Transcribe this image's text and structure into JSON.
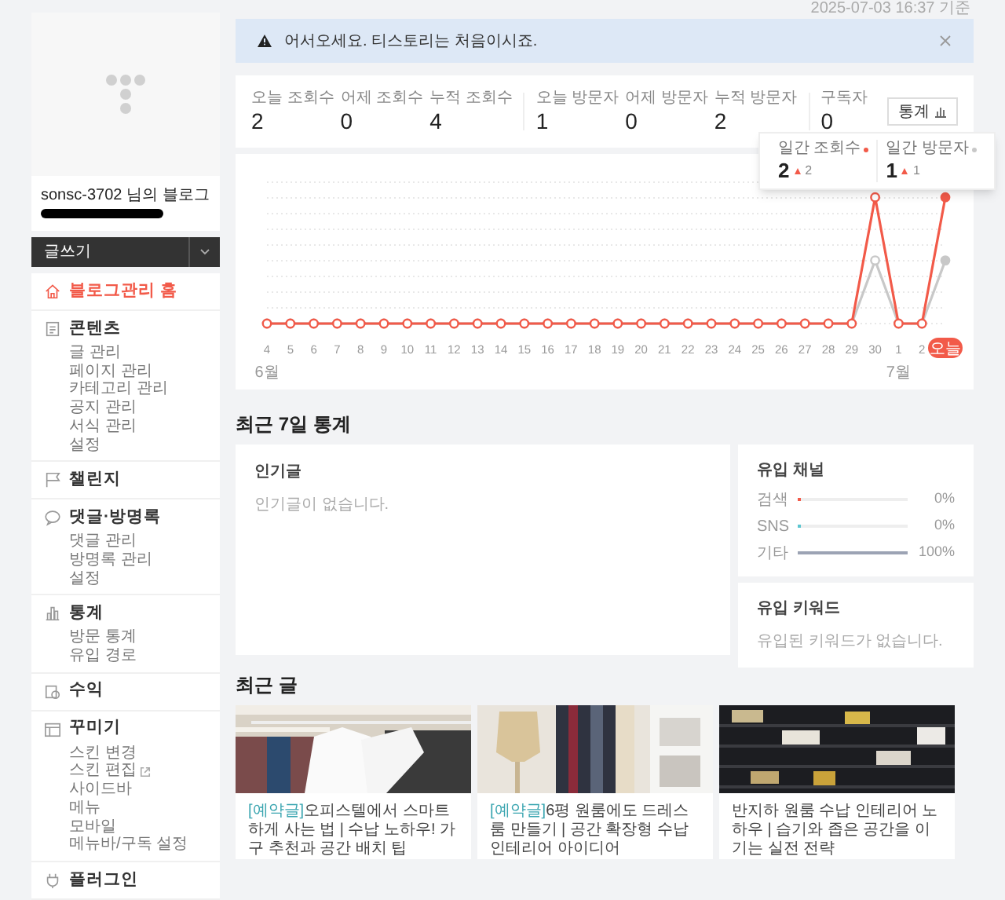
{
  "updated_at": "2025-07-03 16:37 기준",
  "sidebar": {
    "blog_name": "sonsc-3702 님의 블로그",
    "write_button": "글쓰기",
    "menu": [
      {
        "label": "블로그관리 홈",
        "selected": true
      },
      {
        "label": "콘텐츠",
        "selected": false,
        "children": [
          {
            "label": "글 관리",
            "external": false
          },
          {
            "label": "페이지 관리",
            "external": false
          },
          {
            "label": "카테고리 관리",
            "external": false
          },
          {
            "label": "공지 관리",
            "external": false
          },
          {
            "label": "서식 관리",
            "external": false
          },
          {
            "label": "설정",
            "external": false
          }
        ]
      },
      {
        "label": "챌린지",
        "selected": false
      },
      {
        "label": "댓글·방명록",
        "selected": false,
        "children": [
          {
            "label": "댓글 관리",
            "external": false
          },
          {
            "label": "방명록 관리",
            "external": false
          },
          {
            "label": "설정",
            "external": false
          }
        ]
      },
      {
        "label": "통계",
        "selected": false,
        "children": [
          {
            "label": "방문 통계",
            "external": false
          },
          {
            "label": "유입 경로",
            "external": false
          }
        ]
      },
      {
        "label": "수익",
        "selected": false
      },
      {
        "label": "꾸미기",
        "selected": false,
        "children": [
          {
            "label": "스킨 변경",
            "external": false
          },
          {
            "label": "스킨 편집",
            "external": true
          },
          {
            "label": "사이드바",
            "external": false
          },
          {
            "label": "메뉴",
            "external": false
          },
          {
            "label": "모바일",
            "external": false
          },
          {
            "label": "메뉴바/구독 설정",
            "external": false
          }
        ]
      },
      {
        "label": "플러그인",
        "selected": false
      }
    ]
  },
  "alert": {
    "text": "어서오세요. 티스토리는 처음이시죠."
  },
  "stat_groups": [
    {
      "items": [
        {
          "label": "오늘 조회수",
          "value": "2"
        },
        {
          "label": "어제 조회수",
          "value": "0"
        },
        {
          "label": "누적 조회수",
          "value": "4"
        }
      ]
    },
    {
      "items": [
        {
          "label": "오늘 방문자",
          "value": "1"
        },
        {
          "label": "어제 방문자",
          "value": "0"
        },
        {
          "label": "누적 방문자",
          "value": "2"
        }
      ]
    },
    {
      "items": [
        {
          "label": "구독자",
          "value": "0"
        }
      ]
    }
  ],
  "stats_button": "통계",
  "chart": {
    "today_highlighted": true,
    "tooltip": [
      {
        "label": "일간 조회수",
        "value": "2",
        "change": "2",
        "color": "#f25a49"
      },
      {
        "label": "일간 방문자",
        "value": "1",
        "change": "1",
        "color": "#c8c8c8"
      }
    ],
    "x_labels": [
      {
        "label": "4",
        "month": "6월"
      },
      {
        "label": "5"
      },
      {
        "label": "6"
      },
      {
        "label": "7"
      },
      {
        "label": "8"
      },
      {
        "label": "9"
      },
      {
        "label": "10"
      },
      {
        "label": "11"
      },
      {
        "label": "12"
      },
      {
        "label": "13"
      },
      {
        "label": "14"
      },
      {
        "label": "15"
      },
      {
        "label": "16"
      },
      {
        "label": "17"
      },
      {
        "label": "18"
      },
      {
        "label": "19"
      },
      {
        "label": "20"
      },
      {
        "label": "21"
      },
      {
        "label": "22"
      },
      {
        "label": "23"
      },
      {
        "label": "24"
      },
      {
        "label": "25"
      },
      {
        "label": "26"
      },
      {
        "label": "27"
      },
      {
        "label": "28"
      },
      {
        "label": "29"
      },
      {
        "label": "30"
      },
      {
        "label": "1",
        "month": "7월"
      },
      {
        "label": "2"
      },
      {
        "label": "오늘"
      }
    ]
  },
  "weekly": {
    "heading": "최근 7일 통계",
    "popular": {
      "title": "인기글",
      "empty": "인기글이 없습니다."
    },
    "channels": {
      "title": "유입 채널",
      "items": [
        {
          "label": "검색",
          "percent": "0%",
          "level": 0,
          "color": "#f25a49"
        },
        {
          "label": "SNS",
          "percent": "0%",
          "level": 0,
          "color": "#5cc6d0"
        },
        {
          "label": "기타",
          "percent": "100%",
          "level": 1,
          "color": "#9ca3b4"
        }
      ]
    },
    "keywords": {
      "title": "유입 키워드",
      "empty": "유입된 키워드가 없습니다."
    }
  },
  "recent": {
    "heading": "최근 글",
    "posts": [
      {
        "tag": "[예약글]",
        "title": "오피스텔에서 스마트하게 사는 법 | 수납 노하우! 가구 추천과 공간 배치 팁"
      },
      {
        "tag": "[예약글]",
        "title": "6평 원룸에도 드레스룸 만들기 | 공간 확장형 수납 인테리어 아이디어"
      },
      {
        "title": "반지하 원룸 수납 인테리어 노하우 | 습기와 좁은 공간을 이기는 실전 전략"
      }
    ]
  }
}
